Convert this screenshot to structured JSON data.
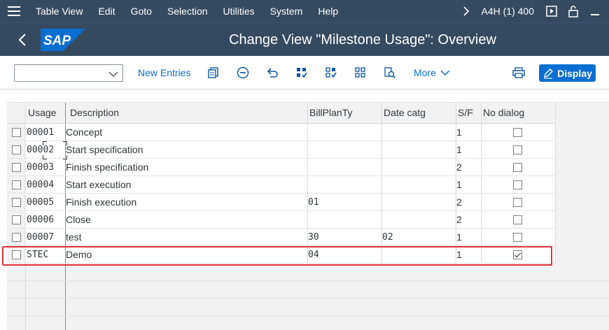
{
  "menubar": {
    "items": [
      "Table View",
      "Edit",
      "Goto",
      "Selection",
      "Utilities",
      "System",
      "Help"
    ],
    "system_name": "A4H (1) 400"
  },
  "shell": {
    "logo_text": "SAP",
    "title": "Change View \"Milestone Usage\": Overview"
  },
  "toolbar": {
    "new_entries": "New Entries",
    "more": "More",
    "display": "Display",
    "select_value": ""
  },
  "table": {
    "columns": [
      "Usage",
      "Description",
      "BillPlanTy",
      "Date catg",
      "S/F",
      "No dialog"
    ],
    "rows": [
      {
        "usage": "00001",
        "description": "Concept",
        "billplanty": "",
        "date_catg": "",
        "sf": "1",
        "no_dialog": false
      },
      {
        "usage": "00002",
        "description": "Start specification",
        "billplanty": "",
        "date_catg": "",
        "sf": "1",
        "no_dialog": false
      },
      {
        "usage": "00003",
        "description": "Finish specification",
        "billplanty": "",
        "date_catg": "",
        "sf": "2",
        "no_dialog": false
      },
      {
        "usage": "00004",
        "description": "Start execution",
        "billplanty": "",
        "date_catg": "",
        "sf": "1",
        "no_dialog": false
      },
      {
        "usage": "00005",
        "description": "Finish execution",
        "billplanty": "01",
        "date_catg": "",
        "sf": "2",
        "no_dialog": false
      },
      {
        "usage": "00006",
        "description": "Close",
        "billplanty": "",
        "date_catg": "",
        "sf": "2",
        "no_dialog": false
      },
      {
        "usage": "00007",
        "description": "test",
        "billplanty": "30",
        "date_catg": "02",
        "sf": "1",
        "no_dialog": false
      },
      {
        "usage": "STEC",
        "description": "Demo",
        "billplanty": "04",
        "date_catg": "",
        "sf": "1",
        "no_dialog": true
      }
    ]
  },
  "colors": {
    "shell_bg": "#354a5f",
    "accent": "#0a6ed1",
    "highlight": "#e3323a",
    "table_bg": "#f2f2f2"
  },
  "icons": [
    "menu-icon",
    "chevron-right-icon",
    "execute-icon",
    "unlock-icon",
    "minimize-icon",
    "back-icon",
    "copy-icon",
    "delete-icon",
    "undo-icon",
    "select-all-icon",
    "select-block-icon",
    "deselect-all-icon",
    "where-used-icon",
    "print-icon",
    "edit-icon"
  ]
}
